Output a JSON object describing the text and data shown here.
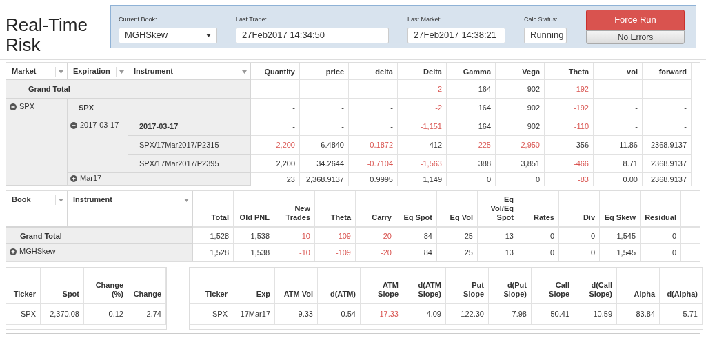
{
  "page_title": "Real-Time Risk",
  "controls": {
    "current_book": {
      "label": "Current Book:",
      "value": "MGHSkew"
    },
    "last_trade": {
      "label": "Last Trade:",
      "value": "27Feb2017 14:34:50"
    },
    "last_market": {
      "label": "Last Market:",
      "value": "27Feb2017 14:38:21"
    },
    "calc_status": {
      "label": "Calc Status:",
      "value": "Running"
    },
    "buttons": [
      "Force Run",
      "No Errors"
    ]
  },
  "risk_table": {
    "row_fields": [
      "Market",
      "Expiration",
      "Instrument"
    ],
    "columns": [
      "Quantity",
      "price",
      "delta",
      "Delta",
      "Gamma",
      "Vega",
      "Theta",
      "vol",
      "forward"
    ],
    "grand_total": {
      "label": "Grand Total",
      "values": [
        "-",
        "-",
        "-",
        "-2",
        "164",
        "902",
        "-192",
        "-",
        "-"
      ]
    },
    "markets": [
      {
        "label": "SPX",
        "expanded": true,
        "subtotal": {
          "label": "SPX",
          "values": [
            "-",
            "-",
            "-",
            "-2",
            "164",
            "902",
            "-192",
            "-",
            "-"
          ]
        },
        "expirations": [
          {
            "label": "2017-03-17",
            "expanded": true,
            "subtotal": {
              "label": "2017-03-17",
              "values": [
                "-",
                "-",
                "-",
                "-1,151",
                "164",
                "902",
                "-110",
                "-",
                "-"
              ]
            },
            "instruments": [
              {
                "label": "SPX/17Mar2017/P2315",
                "values": [
                  "-2,200",
                  "6.4840",
                  "-0.1872",
                  "412",
                  "-225",
                  "-2,950",
                  "356",
                  "11.86",
                  "2368.9137"
                ]
              },
              {
                "label": "SPX/17Mar2017/P2395",
                "values": [
                  "2,200",
                  "34.2644",
                  "-0.7104",
                  "-1,563",
                  "388",
                  "3,851",
                  "-466",
                  "8.71",
                  "2368.9137"
                ]
              }
            ]
          },
          {
            "label": "Mar17",
            "expanded": false,
            "values": [
              "23",
              "2,368.9137",
              "0.9995",
              "1,149",
              "0",
              "0",
              "-83",
              "0.00",
              "2368.9137"
            ]
          }
        ]
      }
    ]
  },
  "pnl_table": {
    "row_fields": [
      "Book",
      "Instrument"
    ],
    "columns": [
      "Total",
      "Old PNL",
      "New Trades",
      "Theta",
      "Carry",
      "Eq Spot",
      "Eq Vol",
      "Eq Vol/Eq Spot",
      "Rates",
      "Div",
      "Eq Skew",
      "Residual"
    ],
    "grand_total": {
      "label": "Grand Total",
      "values": [
        "1,528",
        "1,538",
        "-10",
        "-109",
        "-20",
        "84",
        "25",
        "13",
        "0",
        "0",
        "1,545",
        "0"
      ]
    },
    "books": [
      {
        "label": "MGHSkew",
        "expanded": false,
        "values": [
          "1,528",
          "1,538",
          "-10",
          "-109",
          "-20",
          "84",
          "25",
          "13",
          "0",
          "0",
          "1,545",
          "0"
        ]
      }
    ]
  },
  "spot_table": {
    "columns": [
      "Ticker",
      "Spot",
      "Change (%)",
      "Change"
    ],
    "rows": [
      [
        "SPX",
        "2,370.08",
        "0.12",
        "2.74"
      ]
    ]
  },
  "vol_table": {
    "columns": [
      "Ticker",
      "Exp",
      "ATM Vol",
      "d(ATM)",
      "ATM Slope",
      "d(ATM Slope)",
      "Put Slope",
      "d(Put Slope)",
      "Call Slope",
      "d(Call Slope)",
      "Alpha",
      "d(Alpha)"
    ],
    "rows": [
      [
        "SPX",
        "17Mar17",
        "9.33",
        "0.54",
        "-17.33",
        "4.09",
        "122.30",
        "7.98",
        "50.41",
        "10.59",
        "83.84",
        "5.71"
      ]
    ]
  }
}
